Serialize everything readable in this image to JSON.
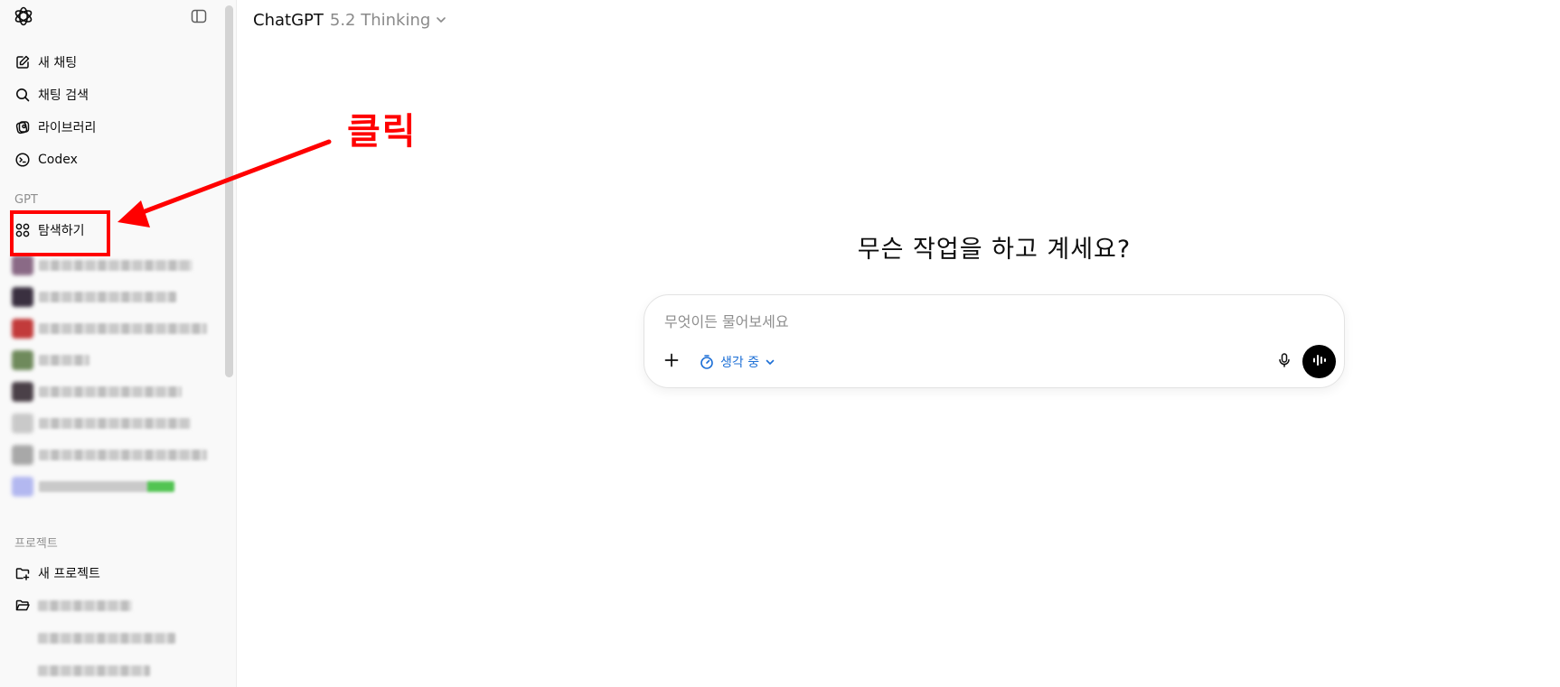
{
  "app": {
    "title": "ChatGPT"
  },
  "model_selector": {
    "name": "ChatGPT",
    "version": "5.2 Thinking"
  },
  "sidebar": {
    "nav": [
      {
        "label": "새 채팅",
        "icon": "edit-icon"
      },
      {
        "label": "채팅 검색",
        "icon": "search-icon"
      },
      {
        "label": "라이브러리",
        "icon": "library-icon"
      },
      {
        "label": "Codex",
        "icon": "codex-icon"
      }
    ],
    "gpt_section_label": "GPT",
    "explore_label": "탐색하기",
    "gpts": [
      {
        "name": "",
        "thumb_color": "#8a6a86"
      },
      {
        "name": "",
        "thumb_color": "#3a3040"
      },
      {
        "name": "",
        "thumb_color": "#c23b3b"
      },
      {
        "name": "",
        "thumb_color": "#6f8a5c"
      },
      {
        "name": "",
        "thumb_color": "#4a4048"
      },
      {
        "name": "",
        "thumb_color": "#c9c9c9"
      },
      {
        "name": "",
        "thumb_color": "#a8a8a8"
      },
      {
        "name": "",
        "thumb_color": "#b3b8f0"
      }
    ],
    "projects_label": "프로젝트",
    "new_project_label": "새 프로젝트",
    "projects": [
      {
        "name": ""
      },
      {
        "name": ""
      },
      {
        "name": ""
      }
    ]
  },
  "main": {
    "headline": "무슨 작업을 하고 계세요?",
    "composer": {
      "placeholder": "무엇이든 물어보세요",
      "value": "",
      "mode_label": "생각 중"
    }
  },
  "annotation": {
    "text": "클릭",
    "color": "#ff0000"
  },
  "colors": {
    "accent_blue": "#1c6fd6",
    "voice_button": "#000000"
  }
}
